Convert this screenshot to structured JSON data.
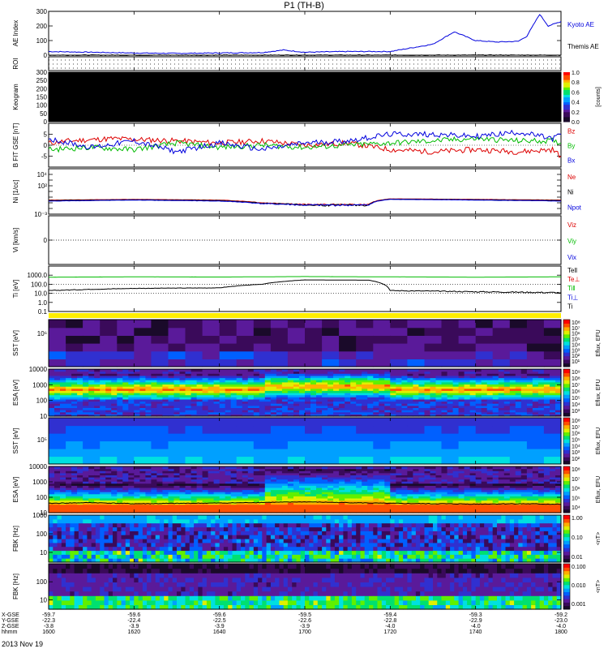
{
  "title": "P1 (TH-B)",
  "date": "2013 Nov 19",
  "colors": {
    "blue": "#0000dd",
    "red": "#dd0000",
    "green": "#00bb00",
    "black": "#000000",
    "yellow": "#ffee00"
  },
  "xaxis": {
    "times": [
      1600,
      1620,
      1640,
      1700,
      1720,
      1740,
      1800
    ],
    "time_labels": [
      "1600",
      "1620",
      "1640",
      "1700",
      "1720",
      "1740",
      "1800"
    ],
    "row_labels": [
      "X-GSE",
      "Y-GSE",
      "Z-GSE",
      "hhmm"
    ],
    "rows": [
      [
        "-59.7",
        "-59.6",
        "-59.6",
        "-59.5",
        "-59.4",
        "-59.3",
        "-59.2"
      ],
      [
        "-22.3",
        "-22.4",
        "-22.5",
        "-22.6",
        "-22.8",
        "-22.9",
        "-23.0"
      ],
      [
        "-3.8",
        "-3.9",
        "-3.9",
        "-3.9",
        "-4.0",
        "-4.0",
        "-4.0"
      ],
      [
        "1600",
        "1620",
        "1640",
        "1700",
        "1720",
        "1740",
        "1800"
      ]
    ]
  },
  "chart_data": [
    {
      "id": "ae",
      "type": "line",
      "ylabel": "AE Index",
      "ylim": [
        0,
        300
      ],
      "yticks": [
        0,
        100,
        200,
        300
      ],
      "ytick_labels": [
        "0",
        "100",
        "200",
        "300"
      ],
      "series": [
        {
          "name": "Kyoto AE",
          "color": "blue",
          "x": [
            1600,
            1610,
            1620,
            1630,
            1640,
            1650,
            1655,
            1700,
            1710,
            1720,
            1725,
            1730,
            1735,
            1740,
            1745,
            1750,
            1752,
            1755,
            1757,
            1800
          ],
          "y": [
            25,
            20,
            15,
            12,
            15,
            18,
            35,
            20,
            25,
            25,
            50,
            75,
            160,
            100,
            90,
            95,
            130,
            280,
            200,
            230
          ]
        },
        {
          "name": "Themis AE",
          "color": "black",
          "x": [
            1600,
            1800
          ],
          "y": [
            0,
            0
          ]
        }
      ]
    },
    {
      "id": "roi",
      "type": "table",
      "ylabel": "ROI",
      "values": []
    },
    {
      "id": "keogram",
      "type": "heatmap",
      "ylabel": "Keogram",
      "ylim": [
        0,
        300
      ],
      "yticks": [
        0,
        50,
        100,
        150,
        200,
        250,
        300
      ],
      "ytick_labels": [
        "0",
        "50",
        "100",
        "150",
        "200",
        "250",
        "300"
      ],
      "colorbar": {
        "label": "[counts]",
        "ticks": [
          0.0,
          0.2,
          0.4,
          0.6,
          0.8,
          1.0
        ],
        "tick_labels": [
          "0.0",
          "0.2",
          "0.4",
          "0.6",
          "0.8",
          "1.0"
        ]
      },
      "values": []
    },
    {
      "id": "bfield",
      "type": "line",
      "ylabel": "B FIT GSE [nT]",
      "ylim": [
        -10,
        10
      ],
      "yticks": [
        -5,
        0,
        5
      ],
      "ytick_labels": [
        "-5",
        "0",
        "5"
      ],
      "series": [
        {
          "name": "Bz",
          "color": "red",
          "x": [
            1600,
            1605,
            1615,
            1630,
            1640,
            1650,
            1700,
            1710,
            1720,
            1730,
            1740,
            1750,
            1758,
            1800
          ],
          "y": [
            1,
            2,
            3,
            2,
            1,
            2,
            0,
            1,
            -2,
            -3,
            -2,
            -3,
            -2,
            -5
          ]
        },
        {
          "name": "By",
          "color": "green",
          "x": [
            1600,
            1610,
            1620,
            1630,
            1640,
            1650,
            1700,
            1710,
            1720,
            1730,
            1740,
            1750,
            1758,
            1800
          ],
          "y": [
            -2,
            -1,
            -2,
            1,
            -1,
            0,
            -1,
            0,
            1,
            2,
            3,
            2,
            2,
            1
          ]
        },
        {
          "name": "Bx",
          "color": "blue",
          "x": [
            1600,
            1610,
            1620,
            1630,
            1640,
            1650,
            1700,
            1710,
            1720,
            1730,
            1740,
            1750,
            1758,
            1800
          ],
          "y": [
            3,
            -1,
            2,
            -3,
            1,
            -2,
            1,
            2,
            5,
            5,
            4,
            6,
            3,
            5
          ]
        }
      ]
    },
    {
      "id": "density",
      "type": "line",
      "ylabel": "Ni [1/cc]",
      "ylog": true,
      "ylim": [
        0.001,
        100000
      ],
      "yticks": [
        0.001,
        0.01,
        0.1,
        1,
        10,
        100,
        1000,
        10000
      ],
      "ytick_labels": [
        "10⁻³",
        "",
        "",
        "",
        "",
        "10²",
        "",
        "10⁴"
      ],
      "series": [
        {
          "name": "Ne",
          "color": "red",
          "x": [
            1600,
            1620,
            1640,
            1650,
            1700,
            1715,
            1720,
            1740,
            1800
          ],
          "y": [
            0.3,
            0.4,
            0.3,
            0.1,
            0.05,
            0.05,
            0.5,
            0.4,
            0.3
          ]
        },
        {
          "name": "Ni",
          "color": "black",
          "x": [
            1600,
            1620,
            1640,
            1650,
            1700,
            1715,
            1720,
            1740,
            1800
          ],
          "y": [
            0.25,
            0.35,
            0.25,
            0.08,
            0.04,
            0.04,
            0.45,
            0.35,
            0.25
          ]
        },
        {
          "name": "Npot",
          "color": "blue",
          "x": [
            1600,
            1620,
            1640,
            1650,
            1700,
            1715,
            1720,
            1740,
            1800
          ],
          "y": [
            0.2,
            0.3,
            0.2,
            0.07,
            0.04,
            0.04,
            0.4,
            0.3,
            0.2
          ]
        }
      ]
    },
    {
      "id": "velocity",
      "type": "line",
      "ylabel": "Vi [km/s]",
      "ylim": [
        -1,
        1
      ],
      "yticks": [
        -1,
        0,
        1
      ],
      "ytick_labels": [
        "",
        "0",
        ""
      ],
      "series": [
        {
          "name": "Viz",
          "color": "red",
          "x": [],
          "y": []
        },
        {
          "name": "Viy",
          "color": "green",
          "x": [],
          "y": []
        },
        {
          "name": "Vix",
          "color": "blue",
          "x": [],
          "y": []
        }
      ]
    },
    {
      "id": "temperature",
      "type": "line",
      "ylabel": "Ti [eV]",
      "ylog": true,
      "ylim": [
        0.1,
        10000
      ],
      "yticks": [
        0.1,
        1,
        10,
        100,
        1000
      ],
      "ytick_labels": [
        "0.1",
        "1.0",
        "10.0",
        "100.0",
        "1000.0"
      ],
      "series": [
        {
          "name": "Tell",
          "color": "black",
          "x": [],
          "y": []
        },
        {
          "name": "Te⊥",
          "color": "red",
          "x": [],
          "y": []
        },
        {
          "name": "Ti‖",
          "color": "green",
          "x": [
            1600,
            1620,
            1640,
            1700,
            1720,
            1740,
            1800
          ],
          "y": [
            600,
            650,
            620,
            700,
            650,
            600,
            650
          ]
        },
        {
          "name": "Ti⊥",
          "color": "blue",
          "x": [],
          "y": []
        },
        {
          "name": "Ti",
          "color": "black",
          "x": [
            1600,
            1620,
            1640,
            1650,
            1700,
            1715,
            1720,
            1740,
            1800
          ],
          "y": [
            20,
            35,
            40,
            100,
            300,
            280,
            20,
            15,
            12
          ]
        }
      ]
    },
    {
      "id": "sst_e",
      "type": "heatmap",
      "ylabel": "SST [eV]",
      "ylog": true,
      "yticks": [
        1000000
      ],
      "ytick_labels": [
        "10⁶"
      ],
      "colorbar": {
        "label": "Eflux, EFU",
        "tick_labels": [
          "10⁸",
          "10⁷",
          "10⁶",
          "10⁵",
          "10⁴",
          "10³",
          "10²",
          "10¹"
        ]
      },
      "values": []
    },
    {
      "id": "esa_e",
      "type": "heatmap",
      "ylabel": "ESA [eV]",
      "ylog": true,
      "ylim": [
        10,
        10000
      ],
      "yticks": [
        10,
        100,
        1000,
        10000
      ],
      "ytick_labels": [
        "10",
        "100",
        "1000",
        "10000"
      ],
      "colorbar": {
        "label": "Eflux, EFU",
        "tick_labels": [
          "10⁹",
          "10⁸",
          "10⁷",
          "10⁶",
          "10⁵",
          "10⁴",
          "10³"
        ]
      },
      "values": []
    },
    {
      "id": "sst_i",
      "type": "heatmap",
      "ylabel": "SST [eV]",
      "ylog": true,
      "yticks": [
        100000
      ],
      "ytick_labels": [
        "10⁵"
      ],
      "colorbar": {
        "label": "Eflux, EFU",
        "tick_labels": [
          "10⁸",
          "10⁷",
          "10⁶",
          "10⁵",
          "10⁴",
          "10³",
          "10²"
        ]
      },
      "values": []
    },
    {
      "id": "esa_i",
      "type": "heatmap",
      "ylabel": "ESA [eV]",
      "ylog": true,
      "ylim": [
        10,
        10000
      ],
      "yticks": [
        10,
        100,
        1000,
        10000
      ],
      "ytick_labels": [
        "10",
        "100",
        "1000",
        "10000"
      ],
      "colorbar": {
        "label": "Eflux, EFU",
        "tick_labels": [
          "10⁸",
          "10⁷",
          "10⁶",
          "10⁵",
          "10⁴"
        ]
      },
      "series": [
        {
          "name": "Vsc",
          "color": "black",
          "x": [
            1600,
            1610,
            1620,
            1640,
            1700,
            1720,
            1740,
            1750,
            1800
          ],
          "y": [
            40,
            45,
            38,
            42,
            50,
            40,
            36,
            38,
            35
          ]
        }
      ]
    },
    {
      "id": "fbk_b",
      "type": "heatmap",
      "ylabel": "FBK [Hz]",
      "ylog": true,
      "ylim": [
        3,
        1000
      ],
      "yticks": [
        10,
        100,
        1000
      ],
      "ytick_labels": [
        "10",
        "100",
        "1000"
      ],
      "colorbar": {
        "label": "<nT>",
        "tick_labels": [
          "1.00",
          "0.10",
          "0.01"
        ]
      },
      "values": []
    },
    {
      "id": "fbk_e",
      "type": "heatmap",
      "ylabel": "FBK [Hz]",
      "ylog": true,
      "ylim": [
        3,
        1000
      ],
      "yticks": [
        10,
        100
      ],
      "ytick_labels": [
        "10",
        "100"
      ],
      "colorbar": {
        "label": "<nT>",
        "tick_labels": [
          "0.100",
          "0.010",
          "0.001"
        ]
      },
      "values": []
    }
  ]
}
